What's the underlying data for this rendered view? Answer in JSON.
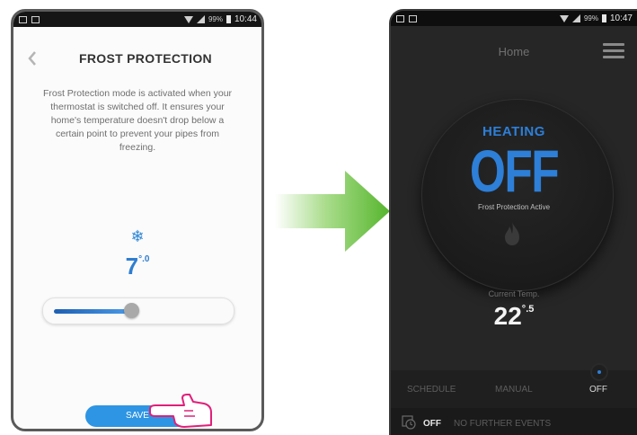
{
  "left_phone": {
    "status": {
      "battery": "99%",
      "time": "10:44"
    },
    "back_icon": "chevron-left-icon",
    "title": "FROST PROTECTION",
    "description": "Frost Protection mode is activated when your thermostat is switched off. It ensures your home's temperature doesn't drop below a certain point to prevent your pipes from freezing.",
    "snow_icon": "❄",
    "temperature": {
      "whole": "7",
      "degree": "°",
      "decimal": ".0"
    },
    "slider": {
      "value_fraction": 0.46
    },
    "save_label": "SAVE",
    "accent_color": "#2f7ed0"
  },
  "right_phone": {
    "status": {
      "battery": "99%",
      "time": "10:47"
    },
    "title": "Home",
    "mode": "HEATING",
    "state": "OFF",
    "frost_label": "Frost Protection Active",
    "current_label": "Current Temp.",
    "current_temp": {
      "whole": "22",
      "degree": "°",
      "decimal": ".5"
    },
    "tabs": [
      "SCHEDULE",
      "MANUAL",
      "OFF"
    ],
    "active_tab": "OFF",
    "bottom": {
      "status": "OFF",
      "events": "NO FURTHER EVENTS"
    },
    "accent_color": "#2d7fd8"
  }
}
